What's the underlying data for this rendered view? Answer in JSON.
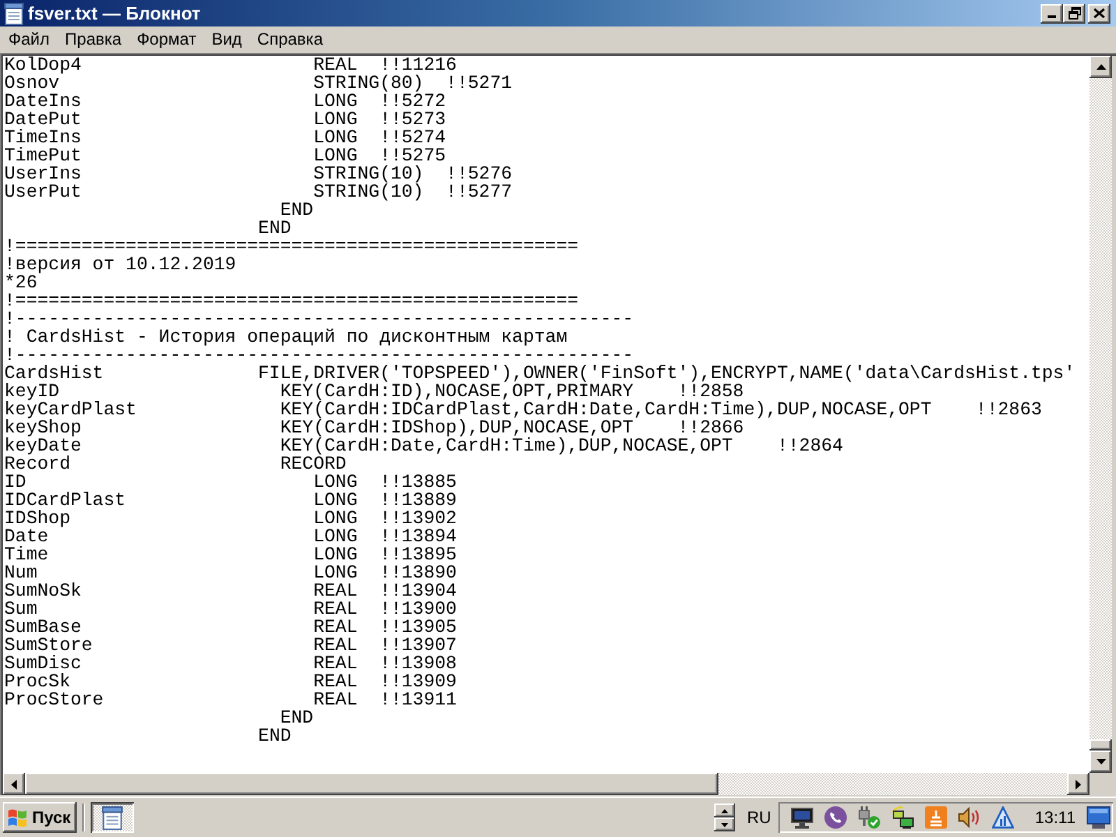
{
  "window": {
    "title": "fsver.txt — Блокнот"
  },
  "menu": [
    "Файл",
    "Правка",
    "Формат",
    "Вид",
    "Справка"
  ],
  "editor": {
    "lines": [
      "KolDop4                     REAL  !!11216",
      "Osnov                       STRING(80)  !!5271",
      "DateIns                     LONG  !!5272",
      "DatePut                     LONG  !!5273",
      "TimeIns                     LONG  !!5274",
      "TimePut                     LONG  !!5275",
      "UserIns                     STRING(10)  !!5276",
      "UserPut                     STRING(10)  !!5277",
      "                         END",
      "                       END",
      "!===================================================",
      "!версия от 10.12.2019",
      "*26",
      "!===================================================",
      "!--------------------------------------------------------",
      "! CardsHist - История операций по дисконтным картам",
      "!--------------------------------------------------------",
      "CardsHist              FILE,DRIVER('TOPSPEED'),OWNER('FinSoft'),ENCRYPT,NAME('data\\CardsHist.tps'",
      "keyID                    KEY(CardH:ID),NOCASE,OPT,PRIMARY    !!2858",
      "keyCardPlast             KEY(CardH:IDCardPlast,CardH:Date,CardH:Time),DUP,NOCASE,OPT    !!2863",
      "keyShop                  KEY(CardH:IDShop),DUP,NOCASE,OPT    !!2866",
      "keyDate                  KEY(CardH:Date,CardH:Time),DUP,NOCASE,OPT    !!2864",
      "Record                   RECORD",
      "ID                          LONG  !!13885",
      "IDCardPlast                 LONG  !!13889",
      "IDShop                      LONG  !!13902",
      "Date                        LONG  !!13894",
      "Time                        LONG  !!13895",
      "Num                         LONG  !!13890",
      "SumNoSk                     REAL  !!13904",
      "Sum                         REAL  !!13900",
      "SumBase                     REAL  !!13905",
      "SumStore                    REAL  !!13907",
      "SumDisc                     REAL  !!13908",
      "ProcSk                      REAL  !!13909",
      "ProcStore                   REAL  !!13911",
      "                         END",
      "                       END"
    ]
  },
  "taskbar": {
    "start": "Пуск",
    "tasks": [
      {
        "active": true
      }
    ],
    "language": "RU",
    "clock": "13:11"
  }
}
